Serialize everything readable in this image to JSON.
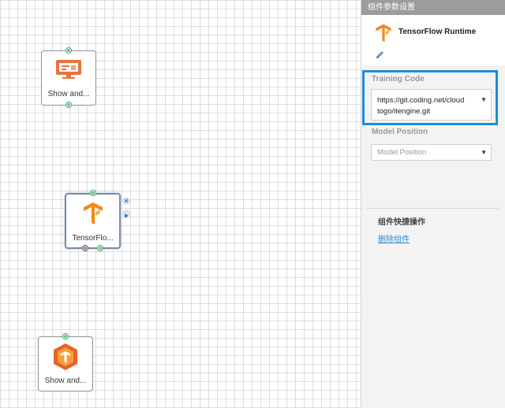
{
  "canvas": {
    "nodes": [
      {
        "label": "Show and...",
        "icon": "monitor-icon"
      },
      {
        "label": "TensorFlo...",
        "icon": "tensorflow-icon"
      },
      {
        "label": "Show and...",
        "icon": "tensorflow-hexagon-icon"
      }
    ]
  },
  "panel": {
    "header": "组件参数设置",
    "component_name": "TensorFlow Runtime",
    "training_code": {
      "label": "Training Code",
      "value_line1": "https://git.coding.net/cloud",
      "value_line2": "togo/itengine.git"
    },
    "model_position": {
      "label": "Model Position",
      "placeholder": "Model Position"
    },
    "quick_actions": {
      "title": "组件快捷操作",
      "delete_link": "删除组件"
    }
  },
  "colors": {
    "accent": "#1e8ed6",
    "tensorflow_orange": "#f08a1c",
    "port_green": "#62c48a",
    "link": "#2a8fd6"
  }
}
